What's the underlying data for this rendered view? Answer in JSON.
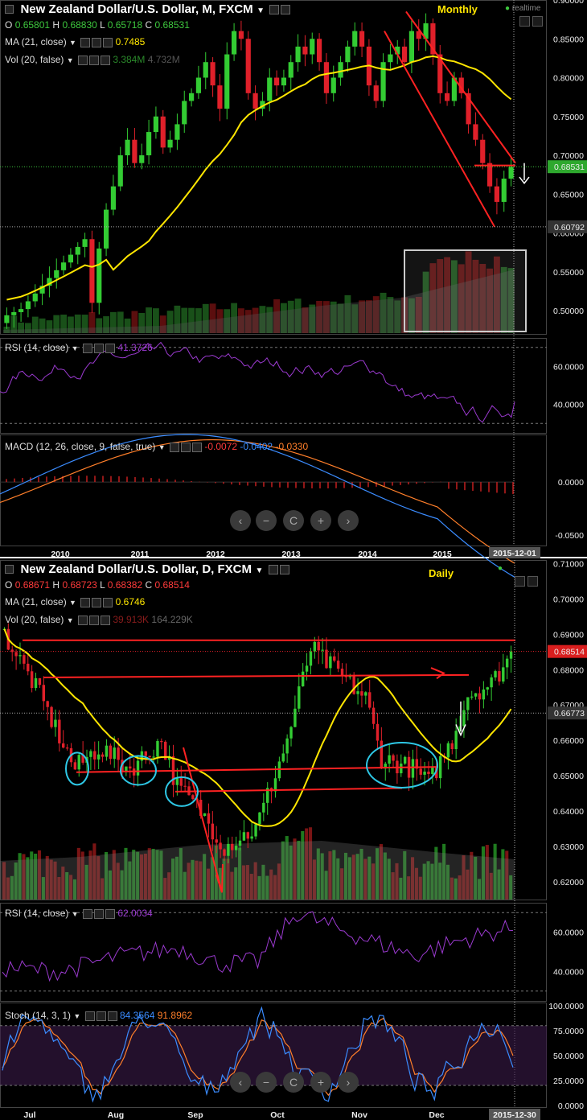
{
  "colors": {
    "up": "#33cc33",
    "down": "#e0202a",
    "ma": "#ffe600",
    "rsi": "#9b3ad0",
    "macd": "#3b8cff",
    "signal": "#ff7f2a",
    "trend": "#ff2222",
    "ellipse": "#2ec8e6"
  },
  "monthly": {
    "title": "New Zealand Dollar/U.S. Dollar, M, FXCM",
    "period_tag": "Monthly",
    "realtime": "realtime",
    "ohlc": {
      "o_label": "O",
      "o": "0.65801",
      "h_label": "H",
      "h": "0.68830",
      "l_label": "L",
      "l": "0.65718",
      "c_label": "C",
      "c": "0.68531"
    },
    "ma": {
      "label": "MA (21, close)",
      "value": "0.7485"
    },
    "vol": {
      "label": "Vol (20, false)",
      "value1": "3.384M",
      "value2": "4.732M"
    },
    "rsi": {
      "label": "RSI (14, close)",
      "value": "41.3726"
    },
    "macd": {
      "label": "MACD (12, 26, close, 9, false, true)",
      "v1": "-0.0072",
      "v2": "-0.0402",
      "v3": "-0.0330"
    },
    "price_ticks": [
      "0.90000",
      "0.85000",
      "0.80000",
      "0.75000",
      "0.70000",
      "0.65000",
      "0.60000",
      "0.55000",
      "0.50000"
    ],
    "price_tag": "0.68531",
    "price_tag2": "0.60792",
    "rsi_ticks": [
      "60.0000",
      "40.0000"
    ],
    "macd_ticks": [
      "0.0000",
      "-0.0500"
    ],
    "x_labels": [
      "2010",
      "2011",
      "2012",
      "2013",
      "2014",
      "2015"
    ],
    "date_tag": "2015-12-01"
  },
  "daily": {
    "title": "New Zealand Dollar/U.S. Dollar, D, FXCM",
    "period_tag": "Daily",
    "ohlc": {
      "o_label": "O",
      "o": "0.68671",
      "h_label": "H",
      "h": "0.68723",
      "l_label": "L",
      "l": "0.68382",
      "c_label": "C",
      "c": "0.68514"
    },
    "ma": {
      "label": "MA (21, close)",
      "value": "0.6746"
    },
    "vol": {
      "label": "Vol (20, false)",
      "value1": "39.913K",
      "value2": "164.229K"
    },
    "rsi": {
      "label": "RSI (14, close)",
      "value": "62.0034"
    },
    "stoch": {
      "label": "Stoch (14, 3, 1)",
      "v1": "84.3564",
      "v2": "91.8962"
    },
    "price_ticks": [
      "0.71000",
      "0.70000",
      "0.69000",
      "0.68000",
      "0.67000",
      "0.66000",
      "0.65000",
      "0.64000",
      "0.63000",
      "0.62000"
    ],
    "price_tag": "0.68514",
    "price_tag2": "0.66773",
    "rsi_ticks": [
      "60.0000",
      "40.0000"
    ],
    "stoch_ticks": [
      "100.0000",
      "75.0000",
      "50.0000",
      "25.0000",
      "0.0000"
    ],
    "x_labels": [
      "Jul",
      "Aug",
      "Sep",
      "Oct",
      "Nov",
      "Dec"
    ],
    "date_tag": "2015-12-30"
  },
  "chart_data": [
    {
      "type": "candlestick",
      "title": "New Zealand Dollar/U.S. Dollar, M, FXCM",
      "timeframe": "Monthly",
      "x": [
        "2010",
        "2011",
        "2012",
        "2013",
        "2014",
        "2015"
      ],
      "ylim": [
        0.47,
        0.9
      ],
      "close_series": [
        0.51,
        0.58,
        0.63,
        0.66,
        0.7,
        0.72,
        0.69,
        0.7,
        0.73,
        0.75,
        0.71,
        0.72,
        0.74,
        0.77,
        0.78,
        0.8,
        0.82,
        0.79,
        0.76,
        0.83,
        0.86,
        0.85,
        0.78,
        0.76,
        0.77,
        0.8,
        0.79,
        0.8,
        0.82,
        0.84,
        0.83,
        0.85,
        0.82,
        0.78,
        0.8,
        0.82,
        0.84,
        0.86,
        0.84,
        0.79,
        0.77,
        0.82,
        0.83,
        0.84,
        0.82,
        0.86,
        0.85,
        0.87,
        0.83,
        0.78,
        0.77,
        0.8,
        0.78,
        0.74,
        0.72,
        0.69,
        0.66,
        0.64,
        0.67,
        0.685
      ],
      "ma21": {
        "name": "MA (21, close)",
        "last": 0.7485
      },
      "current": {
        "o": 0.65801,
        "h": 0.6883,
        "l": 0.65718,
        "c": 0.68531
      }
    },
    {
      "type": "line",
      "title": "RSI (14, close)",
      "last": 41.3726,
      "ylim": [
        25,
        75
      ]
    },
    {
      "type": "line",
      "title": "MACD (12, 26, close, 9, false, true)",
      "series": [
        {
          "values_last": -0.0402
        },
        {
          "values_last": -0.033
        }
      ],
      "histogram_last": -0.0072
    },
    {
      "type": "candlestick",
      "title": "New Zealand Dollar/U.S. Dollar, D, FXCM",
      "timeframe": "Daily",
      "x": [
        "Jul",
        "Aug",
        "Sep",
        "Oct",
        "Nov",
        "Dec"
      ],
      "ylim": [
        0.615,
        0.711
      ],
      "current": {
        "o": 0.68671,
        "h": 0.68723,
        "l": 0.68382,
        "c": 0.68514
      },
      "ma21": {
        "name": "MA (21, close)",
        "last": 0.6746
      }
    },
    {
      "type": "line",
      "title": "RSI (14, close)",
      "last": 62.0034
    },
    {
      "type": "line",
      "title": "Stoch (14, 3, 1)",
      "series": [
        {
          "last": 84.3564
        },
        {
          "last": 91.8962
        }
      ],
      "ylim": [
        0,
        100
      ]
    }
  ]
}
